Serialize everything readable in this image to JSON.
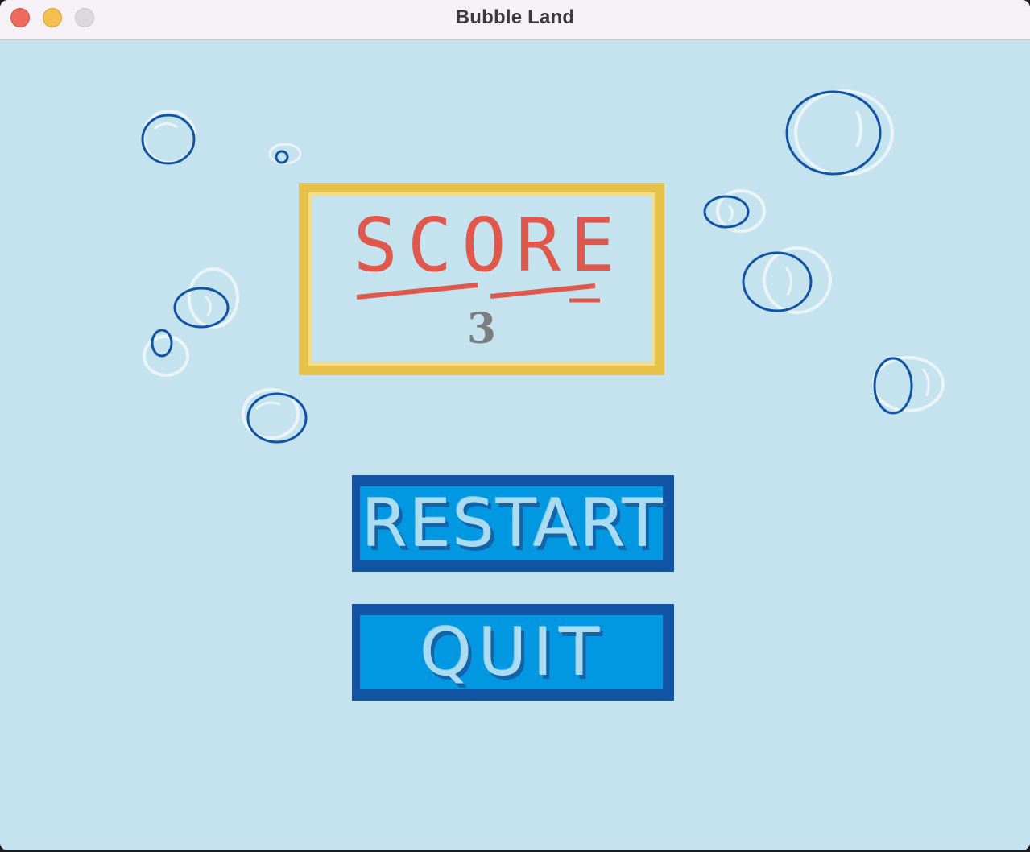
{
  "window": {
    "title": "Bubble Land"
  },
  "score": {
    "heading": "SCORE",
    "value": "3"
  },
  "menu": {
    "restart_label": "RESTART",
    "quit_label": "QUIT"
  },
  "colors": {
    "background": "#c4e3ee",
    "panel_border": "#e7c24a",
    "score_heading": "#e0584c",
    "score_value": "#7b7d80",
    "button_border": "#1153a5",
    "button_face": "#0297e1",
    "button_text": "#a9dcf1",
    "bubble_dark": "#1153a5",
    "bubble_light": "#eaf4f8"
  }
}
